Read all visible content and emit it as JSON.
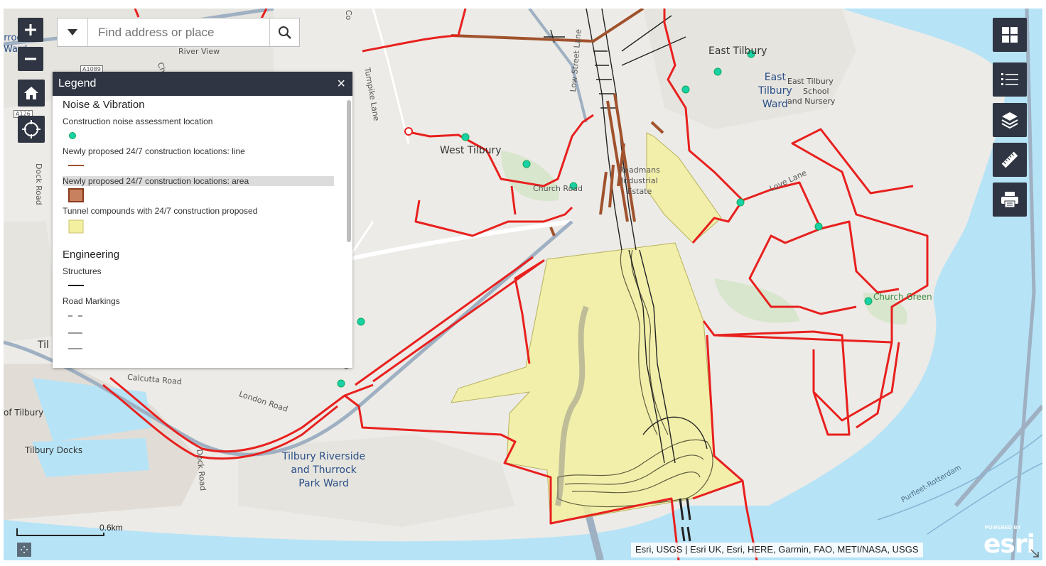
{
  "search": {
    "placeholder": "Find address or place"
  },
  "legend": {
    "title": "Legend",
    "close": "×",
    "groups": [
      {
        "name": "Noise & Vibration",
        "items": [
          "Construction noise assessment location",
          "Newly proposed 24/7 construction locations: line",
          "Newly proposed 24/7 construction locations: area",
          "Tunnel compounds with 24/7 construction proposed"
        ]
      },
      {
        "name": "Engineering",
        "items": [
          "Structures",
          "Road Markings"
        ]
      }
    ]
  },
  "labels": {
    "places": [
      "East Tilbury",
      "West Tilbury",
      "Til",
      "of Tilbury",
      "Tilbury Docks"
    ],
    "wards": [
      "rrock",
      "Ward",
      "East",
      "Tilbury",
      "Ward",
      "Tilbury Riverside",
      "and Thurrock",
      "Park Ward"
    ],
    "roads": [
      "River View",
      "Turnpike Lane",
      "Low Street Lane",
      "Dock Road",
      "Calcutta Road",
      "London Road",
      "Dock Road",
      "A1089",
      "A126",
      "Church Road",
      "Co",
      "Ch",
      "Love Lane",
      "ro"
    ],
    "industrial": [
      "Readmans",
      "Industrial",
      "Estate"
    ],
    "school": [
      "East Tilbury",
      "School",
      "and Nursery"
    ],
    "park": "Church Green",
    "water": "Purfleet-Rotterdam"
  },
  "scale": {
    "label": "0.6km"
  },
  "attribution": "Esri, USGS | Esri UK, Esri, HERE, Garmin, FAO, METI/NASA, USGS",
  "esri": {
    "powered": "POWERED BY",
    "logo": "esri"
  },
  "colors": {
    "boundary": "#e8201e",
    "construction_line": "#a0522d",
    "area": "#c8815f",
    "compound": "#f3f0a0",
    "noise_point": "#19d1a7",
    "water": "#b7e3f6",
    "panel": "#2f3542"
  }
}
